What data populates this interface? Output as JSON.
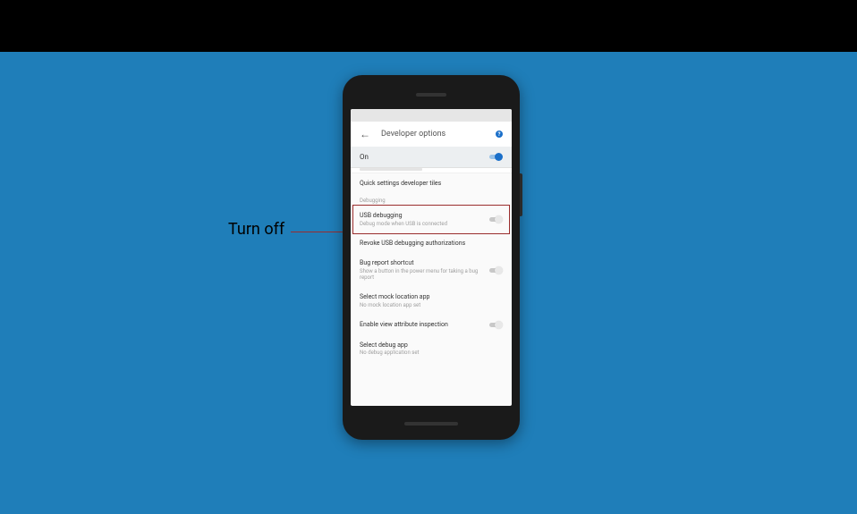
{
  "annotation": {
    "label": "Turn off"
  },
  "header": {
    "title": "Developer options"
  },
  "master": {
    "label": "On",
    "on": true
  },
  "sections": {
    "pre": [
      {
        "title": "Quick settings developer tiles",
        "sub": null,
        "toggle": null
      }
    ],
    "debugging_header": "Debugging",
    "debugging": [
      {
        "title": "USB debugging",
        "sub": "Debug mode when USB is connected",
        "toggle": false,
        "highlight": true
      },
      {
        "title": "Revoke USB debugging authorizations",
        "sub": null,
        "toggle": null
      },
      {
        "title": "Bug report shortcut",
        "sub": "Show a button in the power menu for taking a bug report",
        "toggle": false
      },
      {
        "title": "Select mock location app",
        "sub": "No mock location app set",
        "toggle": null
      },
      {
        "title": "Enable view attribute inspection",
        "sub": null,
        "toggle": false
      },
      {
        "title": "Select debug app",
        "sub": "No debug application set",
        "toggle": null
      }
    ]
  }
}
